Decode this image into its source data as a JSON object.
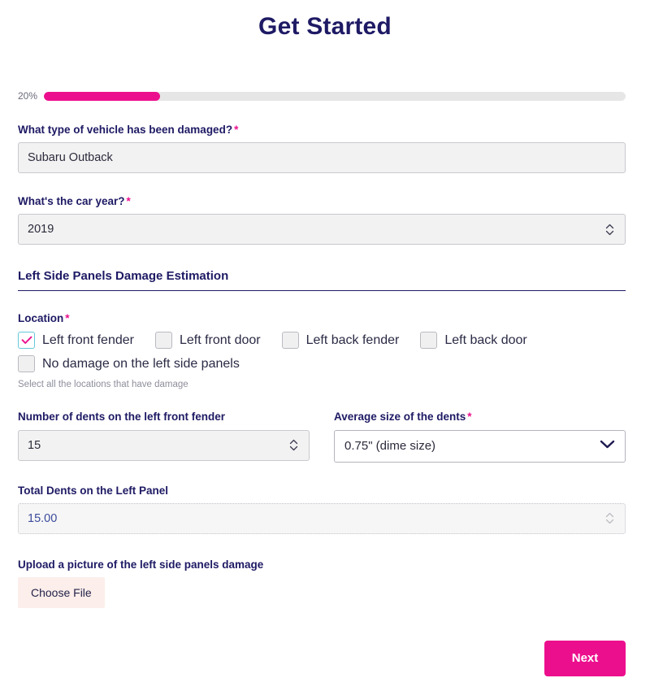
{
  "header": {
    "title": "Get Started"
  },
  "progress": {
    "percent_label": "20%",
    "percent_value": 20,
    "fill_color": "#ec0f8d",
    "track_color": "#e6e6e6"
  },
  "form": {
    "vehicle_type": {
      "label": "What type of vehicle has been damaged?",
      "required_mark": "*",
      "value": "Subaru Outback"
    },
    "car_year": {
      "label": "What's the car year?",
      "required_mark": "*",
      "value": "2019"
    },
    "section_heading": "Left Side Panels Damage Estimation",
    "location": {
      "label": "Location",
      "required_mark": "*",
      "help": "Select all the locations that have damage",
      "options_row1": [
        {
          "label": "Left front fender",
          "checked": true
        },
        {
          "label": "Left front door",
          "checked": false
        },
        {
          "label": "Left back fender",
          "checked": false
        },
        {
          "label": "Left back door",
          "checked": false
        }
      ],
      "options_row2": [
        {
          "label": "No damage on the left side panels",
          "checked": false
        }
      ]
    },
    "dent_count": {
      "label": "Number of dents on the left front fender",
      "value": "15"
    },
    "dent_size": {
      "label": "Average size of the dents",
      "required_mark": "*",
      "value": "0.75\" (dime size)"
    },
    "total_dents": {
      "label": "Total Dents on the Left Panel",
      "value": "15.00"
    },
    "upload": {
      "label": "Upload a picture of the left side panels damage",
      "button_label": "Choose File"
    }
  },
  "footer": {
    "next_label": "Next"
  },
  "colors": {
    "accent": "#ec0f8d",
    "title": "#1e1a64",
    "checked_border": "#63c8d8"
  }
}
